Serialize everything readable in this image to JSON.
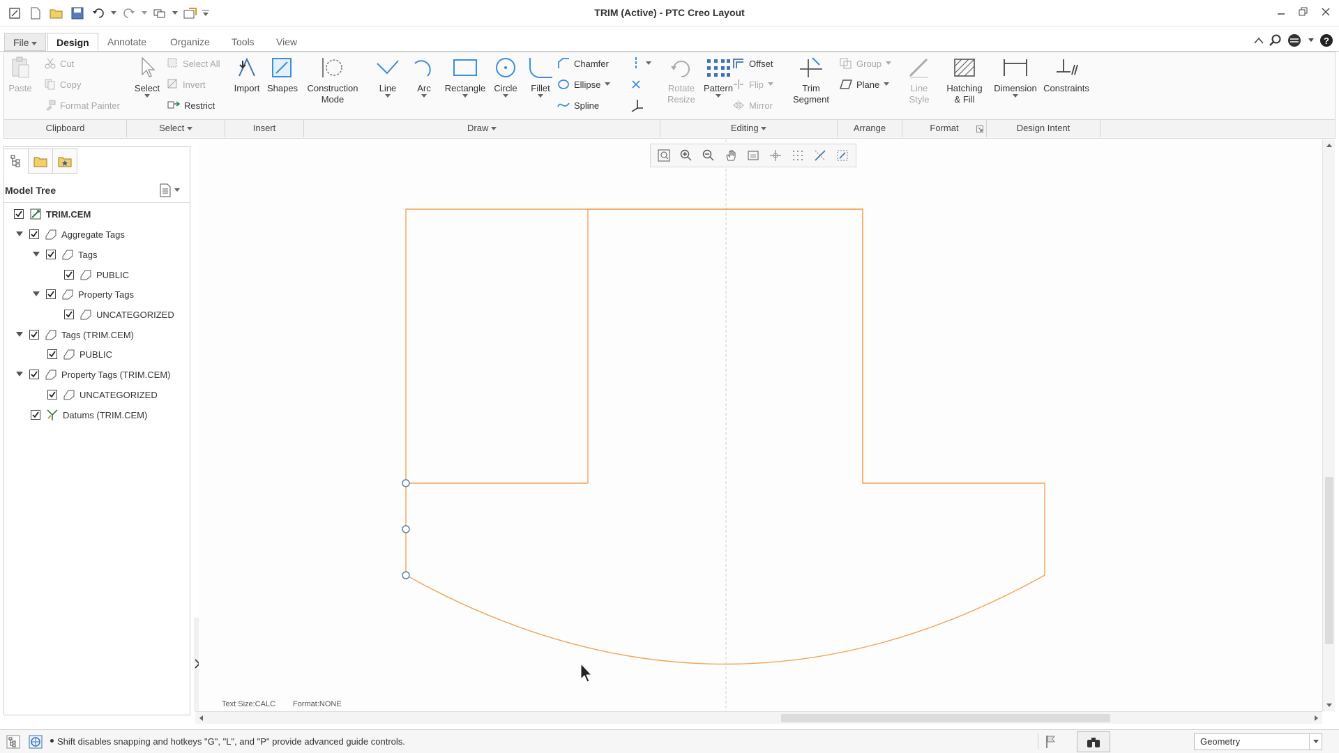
{
  "window": {
    "title": "TRIM (Active) - PTC Creo Layout"
  },
  "tabs": [
    {
      "label": "File",
      "file": true
    },
    {
      "label": "Design",
      "active": true
    },
    {
      "label": "Annotate"
    },
    {
      "label": "Organize"
    },
    {
      "label": "Tools"
    },
    {
      "label": "View"
    }
  ],
  "ribbon": {
    "clipboard": {
      "paste": "Paste",
      "cut": "Cut",
      "copy": "Copy",
      "format_painter": "Format Painter"
    },
    "select": {
      "select": "Select",
      "select_all": "Select All",
      "invert": "Invert",
      "restrict": "Restrict"
    },
    "insert": {
      "import": "Import",
      "shapes": "Shapes"
    },
    "draw": {
      "construction_mode": "Construction\nMode",
      "line": "Line",
      "arc": "Arc",
      "rectangle": "Rectangle",
      "circle": "Circle",
      "fillet": "Fillet",
      "chamfer": "Chamfer",
      "ellipse": "Ellipse",
      "spline": "Spline"
    },
    "editing": {
      "rotate_resize": "Rotate\nResize",
      "pattern": "Pattern",
      "offset": "Offset",
      "flip": "Flip",
      "mirror": "Mirror",
      "trim_segment": "Trim\nSegment"
    },
    "arrange": {
      "group": "Group",
      "plane": "Plane"
    },
    "format": {
      "line_style": "Line\nStyle",
      "hatching_fill": "Hatching\n& Fill"
    },
    "design_intent": {
      "dimension": "Dimension",
      "constraints": "Constraints"
    },
    "groups": [
      "Clipboard",
      "Select",
      "Insert",
      "Draw",
      "Editing",
      "Arrange",
      "Format",
      "Design Intent"
    ]
  },
  "model_tree": {
    "title": "Model Tree",
    "items": [
      {
        "label": "TRIM.CEM",
        "bold": true
      },
      {
        "label": "Aggregate Tags"
      },
      {
        "label": "Tags"
      },
      {
        "label": "PUBLIC"
      },
      {
        "label": "Property Tags"
      },
      {
        "label": "UNCATEGORIZED"
      },
      {
        "label": "Tags (TRIM.CEM)"
      },
      {
        "label": "PUBLIC"
      },
      {
        "label": "Property Tags (TRIM.CEM)"
      },
      {
        "label": "UNCATEGORIZED"
      },
      {
        "label": "Datums (TRIM.CEM)"
      }
    ]
  },
  "canvas": {
    "text_size": "Text Size:CALC",
    "format": "Format:NONE",
    "sketch_color": "#f2a453",
    "point_color": "#4a7fb5"
  },
  "status": {
    "message": "Shift disables snapping and hotkeys \"G\", \"L\", and \"P\" provide advanced guide controls.",
    "filter": "Geometry"
  }
}
